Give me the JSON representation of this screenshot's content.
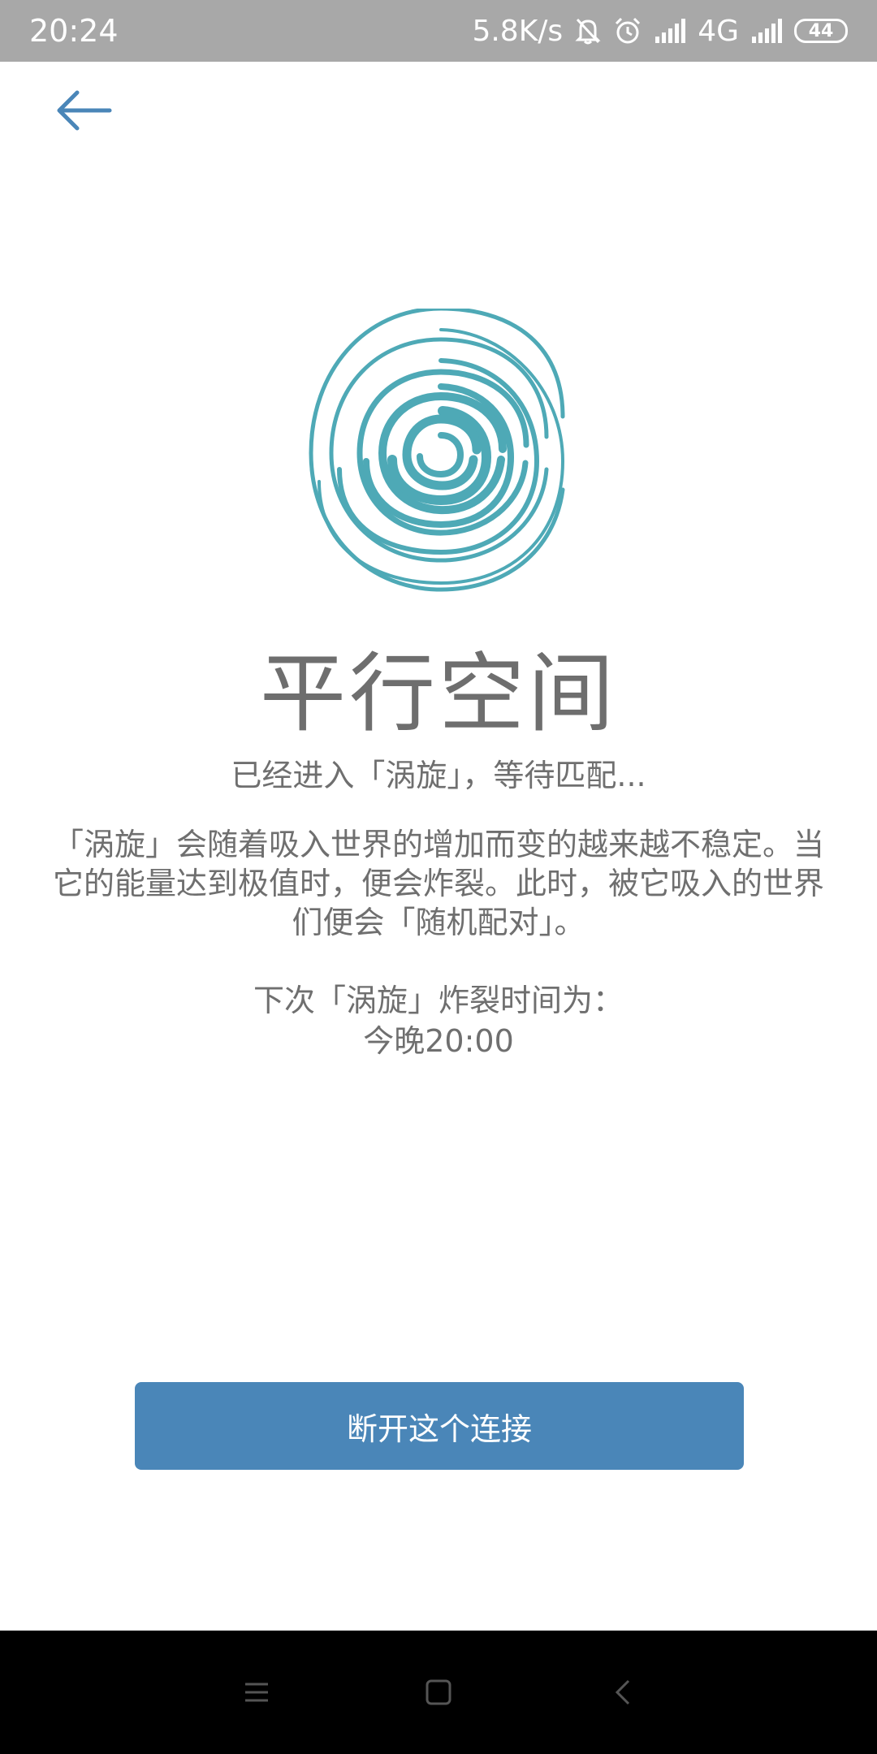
{
  "status_bar": {
    "time": "20:24",
    "network_speed": "5.8K/s",
    "network_type": "4G",
    "battery_level": "44",
    "icons": [
      "mute-bell-icon",
      "alarm-icon",
      "signal-icon",
      "signal-icon"
    ]
  },
  "header": {
    "back_icon": "arrow-left-icon"
  },
  "hero": {
    "icon": "vortex-icon",
    "accent_color": "#4ea9b6"
  },
  "main": {
    "title": "平行空间",
    "subtitle": "已经进入「涡旋」，等待匹配...",
    "description": "「涡旋」会随着吸入世界的增加而变的越来越不稳定。当它的能量达到极值时，便会炸裂。此时，被它吸入的世界们便会「随机配对」。",
    "next_burst_label": "下次「涡旋」炸裂时间为：",
    "next_burst_time": "今晚20:00"
  },
  "actions": {
    "disconnect_label": "断开这个连接",
    "button_color": "#4a86b8"
  },
  "nav_bar": {
    "icons": [
      "menu-icon",
      "home-square-icon",
      "back-chevron-icon"
    ]
  }
}
